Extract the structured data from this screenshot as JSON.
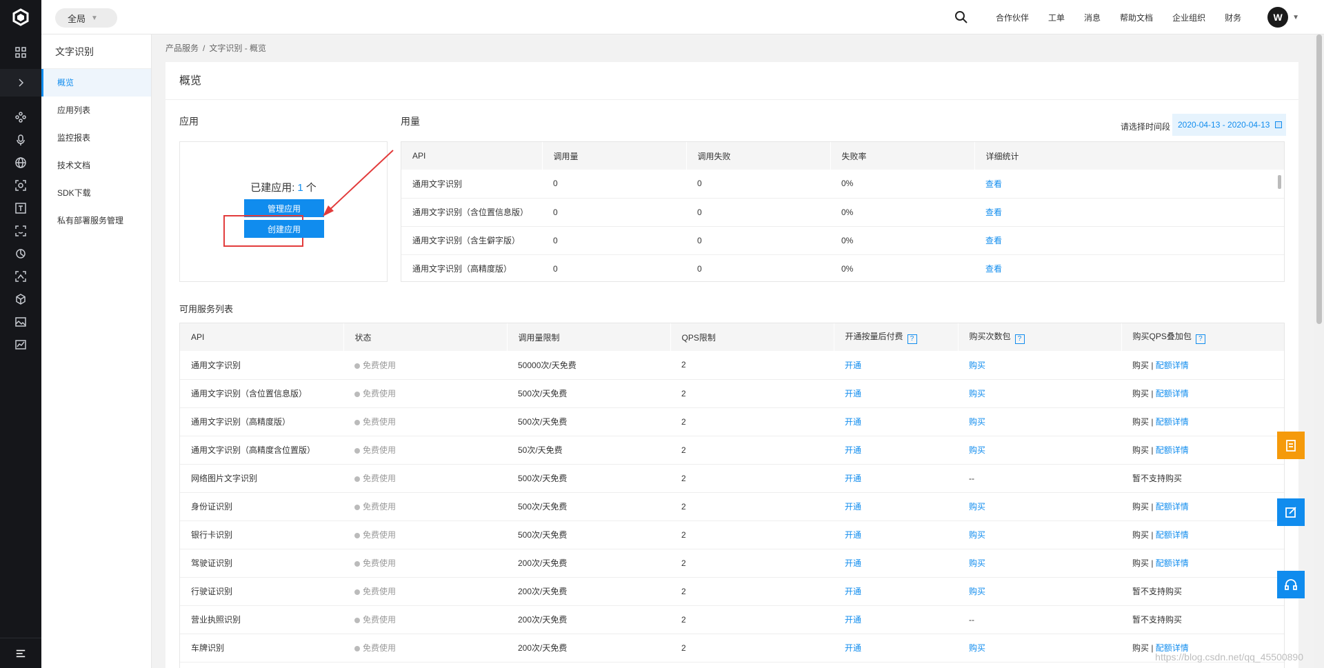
{
  "topbar": {
    "scope": "全局",
    "nav": [
      "合作伙伴",
      "工单",
      "消息",
      "帮助文档",
      "企业组织",
      "财务"
    ],
    "avatar": "W"
  },
  "sidebar": {
    "title": "文字识别",
    "items": [
      {
        "label": "概览",
        "active": true
      },
      {
        "label": "应用列表"
      },
      {
        "label": "监控报表"
      },
      {
        "label": "技术文档"
      },
      {
        "label": "SDK下载"
      },
      {
        "label": "私有部署服务管理"
      }
    ]
  },
  "breadcrumb": [
    "产品服务",
    "文字识别 - 概览"
  ],
  "page_title": "概览",
  "apps": {
    "label": "应用",
    "created_prefix": "已建应用:",
    "created_count": "1",
    "created_suffix": "个",
    "manage_button": "管理应用",
    "create_button": "创建应用"
  },
  "usage": {
    "label": "用量",
    "date_label": "请选择时间段",
    "date_range": "2020-04-13 - 2020-04-13",
    "headers": [
      "API",
      "调用量",
      "调用失败",
      "失败率",
      "详细统计"
    ],
    "rows": [
      [
        "通用文字识别",
        "0",
        "0",
        "0%",
        "查看"
      ],
      [
        "通用文字识别（含位置信息版）",
        "0",
        "0",
        "0%",
        "查看"
      ],
      [
        "通用文字识别（含生僻字版）",
        "0",
        "0",
        "0%",
        "查看"
      ],
      [
        "通用文字识别（高精度版）",
        "0",
        "0",
        "0%",
        "查看"
      ]
    ]
  },
  "services": {
    "label": "可用服务列表",
    "headers": [
      "API",
      "状态",
      "调用量限制",
      "QPS限制",
      "开通按量后付费",
      "购买次数包",
      "购买QPS叠加包"
    ],
    "help_mark": "?",
    "rows": [
      [
        "通用文字识别",
        "免费使用",
        "50000次/天免费",
        "2",
        "开通",
        "购买",
        "购买 | ",
        "配额详情"
      ],
      [
        "通用文字识别（含位置信息版）",
        "免费使用",
        "500次/天免费",
        "2",
        "开通",
        "购买",
        "购买 | ",
        "配额详情"
      ],
      [
        "通用文字识别（高精度版）",
        "免费使用",
        "500次/天免费",
        "2",
        "开通",
        "购买",
        "购买 | ",
        "配额详情"
      ],
      [
        "通用文字识别（高精度含位置版）",
        "免费使用",
        "50次/天免费",
        "2",
        "开通",
        "购买",
        "购买 | ",
        "配额详情"
      ],
      [
        "网络图片文字识别",
        "免费使用",
        "500次/天免费",
        "2",
        "开通",
        "--",
        "暂不支持购买",
        ""
      ],
      [
        "身份证识别",
        "免费使用",
        "500次/天免费",
        "2",
        "开通",
        "购买",
        "购买 | ",
        "配额详情"
      ],
      [
        "银行卡识别",
        "免费使用",
        "500次/天免费",
        "2",
        "开通",
        "购买",
        "购买 | ",
        "配额详情"
      ],
      [
        "驾驶证识别",
        "免费使用",
        "200次/天免费",
        "2",
        "开通",
        "购买",
        "购买 | ",
        "配额详情"
      ],
      [
        "行驶证识别",
        "免费使用",
        "200次/天免费",
        "2",
        "开通",
        "购买",
        "暂不支持购买",
        ""
      ],
      [
        "营业执照识别",
        "免费使用",
        "200次/天免费",
        "2",
        "开通",
        "--",
        "暂不支持购买",
        ""
      ],
      [
        "车牌识别",
        "免费使用",
        "200次/天免费",
        "2",
        "开通",
        "购买",
        "购买 | ",
        "配额详情"
      ]
    ]
  },
  "watermark": "https://blog.csdn.net/qq_45500890",
  "colors": {
    "accent": "#108cee",
    "rail": "#15161a",
    "float_orange": "#f59a0b",
    "highlight": "#e23b3b"
  }
}
